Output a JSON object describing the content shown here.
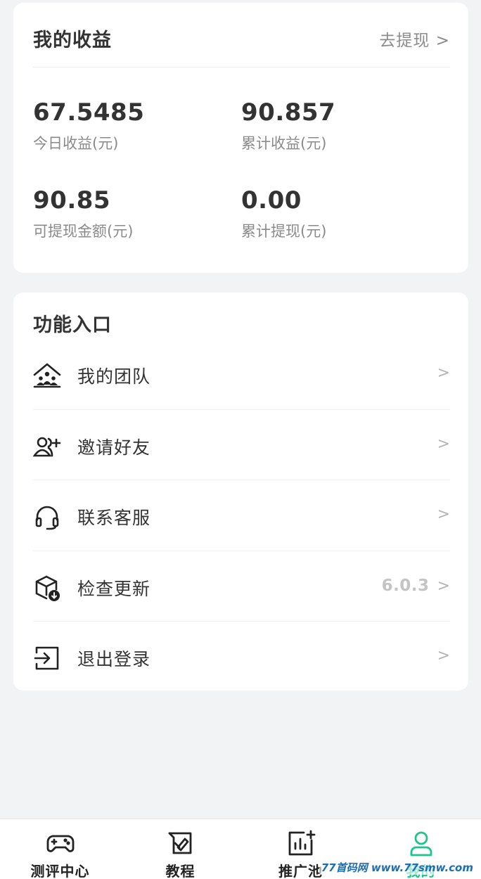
{
  "earnings": {
    "title": "我的收益",
    "withdraw_link": "去提现 >",
    "stats": [
      {
        "value": "67.5485",
        "label": "今日收益(元)"
      },
      {
        "value": "90.857",
        "label": "累计收益(元)"
      },
      {
        "value": "90.85",
        "label": "可提现金额(元)"
      },
      {
        "value": "0.00",
        "label": "累计提现(元)"
      }
    ]
  },
  "functions": {
    "title": "功能入口",
    "items": [
      {
        "label": "我的团队",
        "icon": "team-house-icon",
        "right": "",
        "arrow": ">"
      },
      {
        "label": "邀请好友",
        "icon": "add-user-icon",
        "right": "",
        "arrow": ">"
      },
      {
        "label": "联系客服",
        "icon": "headset-icon",
        "right": "",
        "arrow": ">"
      },
      {
        "label": "检查更新",
        "icon": "update-box-icon",
        "right": "6.0.3",
        "arrow": ">"
      },
      {
        "label": "退出登录",
        "icon": "logout-icon",
        "right": "",
        "arrow": ">"
      }
    ]
  },
  "bottom_nav": {
    "items": [
      {
        "label": "测评中心",
        "icon": "gamepad-icon",
        "active": false
      },
      {
        "label": "教程",
        "icon": "tutorial-icon",
        "active": false
      },
      {
        "label": "推广池",
        "icon": "chart-plus-icon",
        "active": false
      },
      {
        "label": "我的",
        "icon": "user-icon",
        "active": true
      }
    ]
  },
  "watermark": "77首码网 www.77smw.com",
  "colors": {
    "accent": "#20c38a",
    "background": "#f2f3f5",
    "card": "#ffffff",
    "text_primary": "#333333",
    "text_secondary": "#8a8a8a"
  }
}
